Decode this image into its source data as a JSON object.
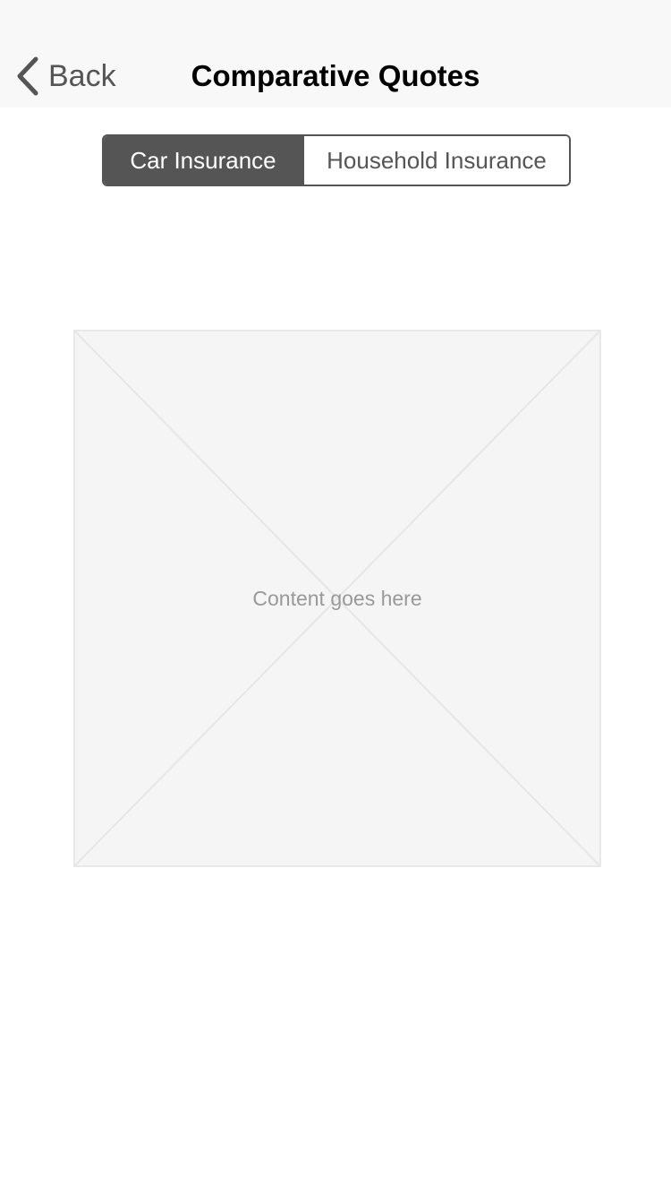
{
  "navbar": {
    "back_label": "Back",
    "back_icon": "chevron-left-icon",
    "title": "Comparative Quotes"
  },
  "segmented_control": {
    "options": [
      {
        "label": "Car Insurance",
        "selected": true
      },
      {
        "label": "Household Insurance",
        "selected": false
      }
    ]
  },
  "content": {
    "placeholder_text": "Content goes here"
  },
  "colors": {
    "navbar_bg": "#f8f8f8",
    "segment_active_bg": "#555555",
    "placeholder_bg": "#f5f5f5"
  }
}
